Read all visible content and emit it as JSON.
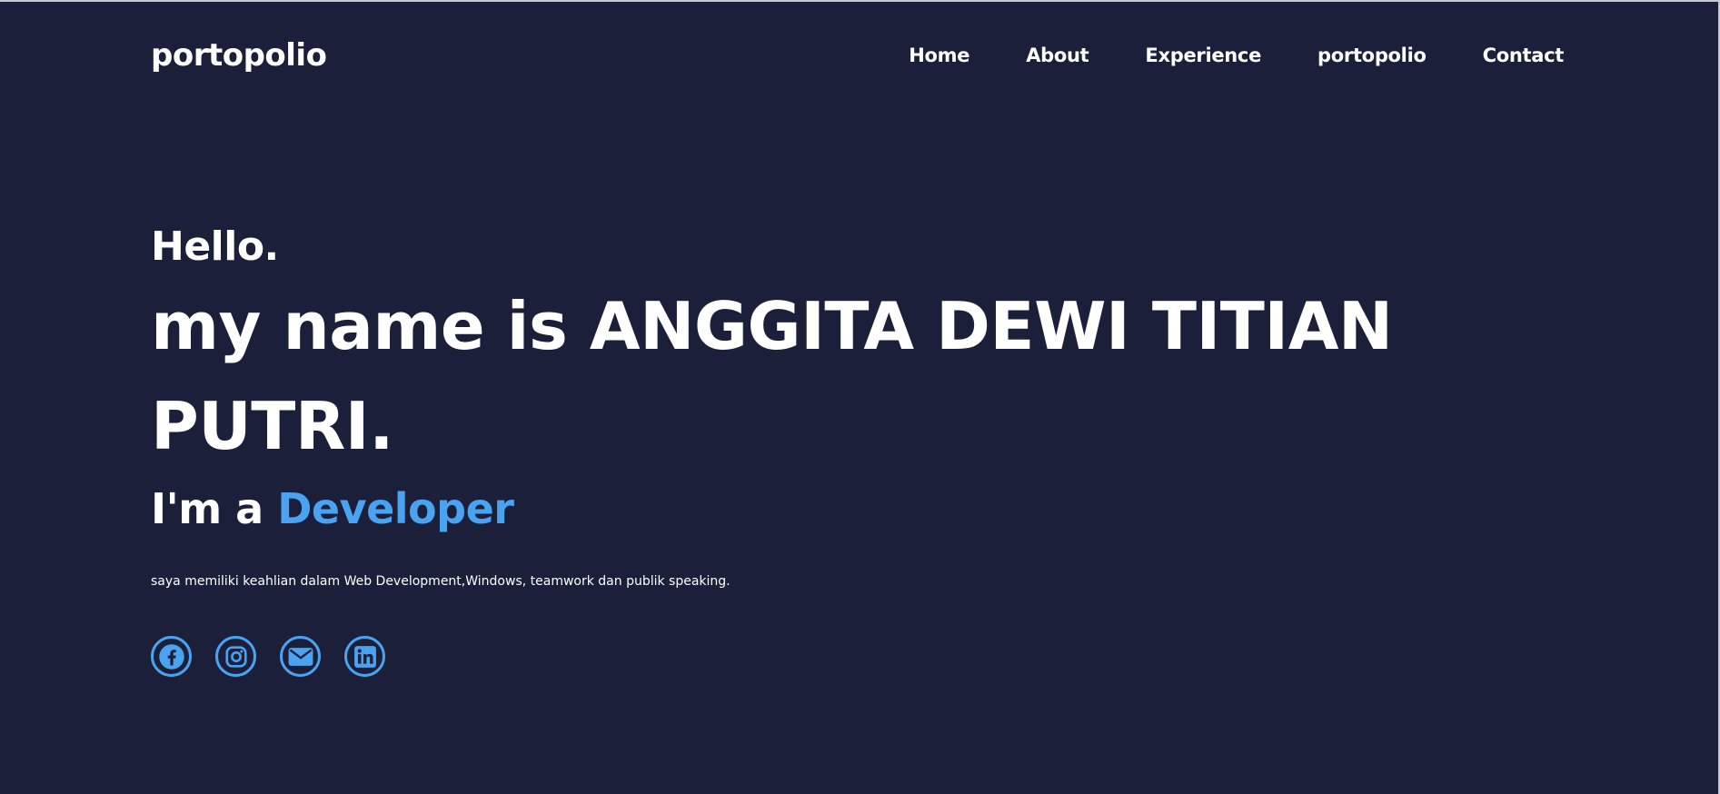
{
  "brand": "portopolio",
  "nav": {
    "items": [
      {
        "label": "Home"
      },
      {
        "label": "About"
      },
      {
        "label": "Experience"
      },
      {
        "label": "portopolio"
      },
      {
        "label": "Contact"
      }
    ]
  },
  "hero": {
    "greeting": "Hello.",
    "name_line": "my name is ANGGITA DEWI TITIAN PUTRI.",
    "role_prefix": "I'm a ",
    "role": "Developer",
    "description": "saya memiliki keahlian dalam Web Development,Windows, teamwork dan publik speaking."
  },
  "socials": [
    {
      "icon": "facebook-icon"
    },
    {
      "icon": "instagram-icon"
    },
    {
      "icon": "email-icon"
    },
    {
      "icon": "linkedin-icon"
    }
  ],
  "colors": {
    "background": "#1b1f3a",
    "accent": "#4aa3f0",
    "text": "#ffffff"
  }
}
